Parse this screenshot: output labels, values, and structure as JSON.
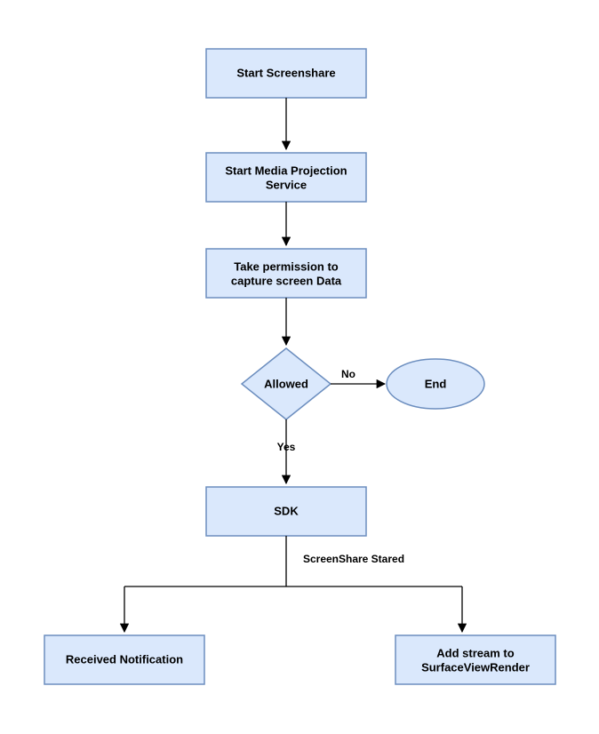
{
  "nodes": {
    "start": "Start Screenshare",
    "media_line1": "Start Media Projection",
    "media_line2": "Service",
    "perm_line1": "Take permission to",
    "perm_line2": "capture screen Data",
    "decision": "Allowed",
    "end": "End",
    "sdk": "SDK",
    "received": "Received Notification",
    "add_line1": "Add stream to",
    "add_line2": "SurfaceViewRender"
  },
  "edges": {
    "no": "No",
    "yes": "Yes",
    "stared": "ScreenShare Stared"
  },
  "colors": {
    "fill": "#dae8fc",
    "stroke": "#6c8ebf"
  }
}
